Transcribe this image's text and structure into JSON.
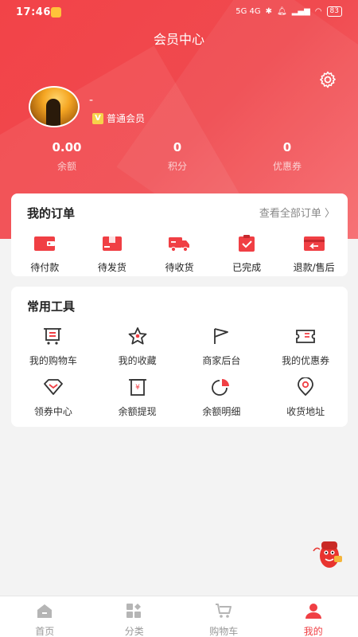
{
  "status_bar": {
    "time": "17:46",
    "network": "5G 4G",
    "battery": "83"
  },
  "header": {
    "title": "会员中心"
  },
  "profile": {
    "username": "-",
    "member_level": "普通会员"
  },
  "stats": [
    {
      "value": "0.00",
      "label": "余额"
    },
    {
      "value": "0",
      "label": "积分"
    },
    {
      "value": "0",
      "label": "优惠券"
    }
  ],
  "orders": {
    "title": "我的订单",
    "view_all": "查看全部订单 〉",
    "items": [
      {
        "label": "待付款",
        "icon": "wallet-icon"
      },
      {
        "label": "待发货",
        "icon": "package-icon"
      },
      {
        "label": "待收货",
        "icon": "truck-icon"
      },
      {
        "label": "已完成",
        "icon": "clipboard-check-icon"
      },
      {
        "label": "退款/售后",
        "icon": "refund-icon"
      }
    ]
  },
  "tools": {
    "title": "常用工具",
    "items": [
      {
        "label": "我的购物车",
        "icon": "cart-icon"
      },
      {
        "label": "我的收藏",
        "icon": "star-icon"
      },
      {
        "label": "商家后台",
        "icon": "flag-icon"
      },
      {
        "label": "我的优惠券",
        "icon": "coupon-icon"
      },
      {
        "label": "领券中心",
        "icon": "diamond-icon"
      },
      {
        "label": "余额提现",
        "icon": "withdraw-icon"
      },
      {
        "label": "余额明细",
        "icon": "pie-icon"
      },
      {
        "label": "收货地址",
        "icon": "location-icon"
      }
    ]
  },
  "tabbar": {
    "items": [
      {
        "label": "首页",
        "icon": "home-icon"
      },
      {
        "label": "分类",
        "icon": "category-icon"
      },
      {
        "label": "购物车",
        "icon": "cart-icon"
      },
      {
        "label": "我的",
        "icon": "user-icon"
      }
    ],
    "active_index": 3
  },
  "colors": {
    "brand": "#f03f44",
    "background": "#f3f3f3"
  }
}
